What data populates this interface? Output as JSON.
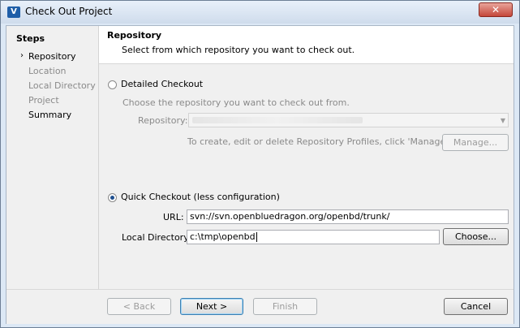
{
  "window": {
    "title": "Check Out Project",
    "close_label": "✕",
    "icon": "V"
  },
  "steps": {
    "heading": "Steps",
    "items": [
      {
        "label": "Repository",
        "state": "active"
      },
      {
        "label": "Location",
        "state": "pending"
      },
      {
        "label": "Local Directory",
        "state": "pending"
      },
      {
        "label": "Project",
        "state": "pending"
      },
      {
        "label": "Summary",
        "state": "done"
      }
    ]
  },
  "header": {
    "title": "Repository",
    "description": "Select from which repository you want to check out."
  },
  "detailed": {
    "label": "Detailed Checkout",
    "hint": "Choose the repository you want to check out from.",
    "repository_label": "Repository:",
    "repository_value": "",
    "manage_hint": "To create, edit or delete Repository Profiles, click 'Manage'.",
    "manage_button": "Manage..."
  },
  "quick": {
    "label": "Quick Checkout (less configuration)",
    "url_label": "URL:",
    "url_value": "svn://svn.openbluedragon.org/openbd/trunk/",
    "dir_label": "Local Directory:",
    "dir_value": "c:\\tmp\\openbd",
    "choose_button": "Choose..."
  },
  "footer": {
    "back": "< Back",
    "next": "Next >",
    "finish": "Finish",
    "cancel": "Cancel"
  }
}
